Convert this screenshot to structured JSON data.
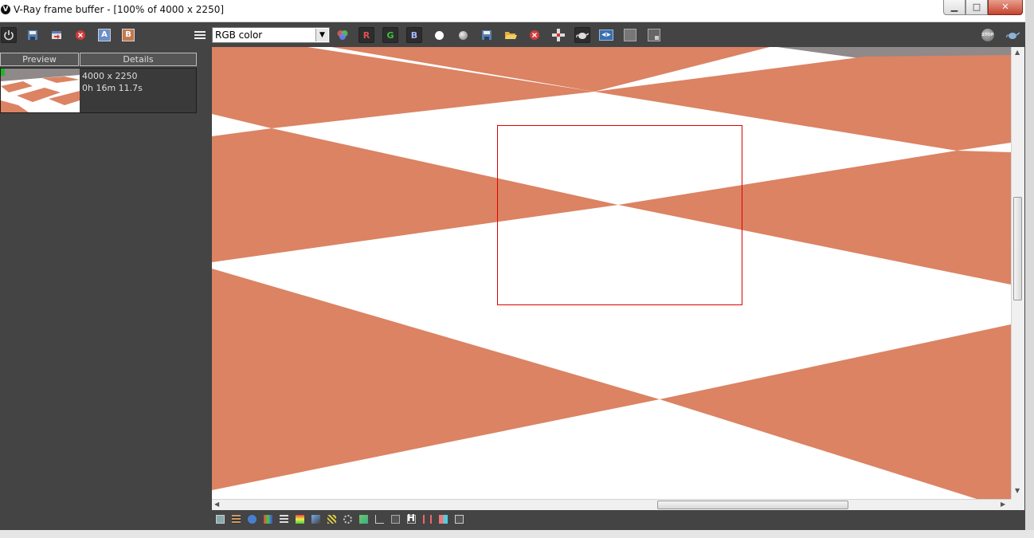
{
  "window": {
    "title": "V-Ray frame buffer - [100% of 4000 x 2250]",
    "controls": {
      "minimize": "▁",
      "maximize": "□",
      "close": "✕"
    }
  },
  "toolbar": {
    "channel_select": {
      "value": "RGB color",
      "options_visible": [
        "RGB color"
      ]
    },
    "left_buttons": [
      "power-icon",
      "save-icon",
      "load-icon",
      "clear-icon",
      "ab-a-icon",
      "ab-b-icon"
    ],
    "channel_buttons": {
      "r": "R",
      "g": "G",
      "b": "B"
    },
    "right_buttons": [
      "white-dot-icon",
      "gray-dot-icon",
      "save-image-icon",
      "open-image-icon",
      "clear-image-icon",
      "track-mouse-icon",
      "render-teapot-icon",
      "lut-icon",
      "region-icon",
      "region-render-icon"
    ],
    "far_right": [
      "stop-icon",
      "teapot-icon"
    ],
    "colors": {
      "r": "#e05050",
      "g": "#40c040",
      "b": "#6080ff"
    }
  },
  "history": {
    "tabs": [
      "Preview",
      "Details"
    ],
    "items": [
      {
        "resolution": "4000 x 2250",
        "time": "0h 16m 11.7s"
      }
    ]
  },
  "viewport": {
    "checker_color": "#db8363",
    "background": "#ffffff",
    "horizon_color": "#8f8989",
    "selection_color": "#e00000"
  },
  "statusbar": {
    "icons": [
      "display-icon",
      "film-icon",
      "info-icon",
      "color-corrections-icon",
      "levels-icon",
      "curves-icon",
      "hsl-icon",
      "exposure-icon",
      "white-balance-icon",
      "lut-bottom-icon",
      "histogram-icon",
      "ocio-icon",
      "icc-icon",
      "h-icon",
      "split-icon",
      "compare-icon",
      "settings-icon"
    ],
    "h_label": "H"
  }
}
